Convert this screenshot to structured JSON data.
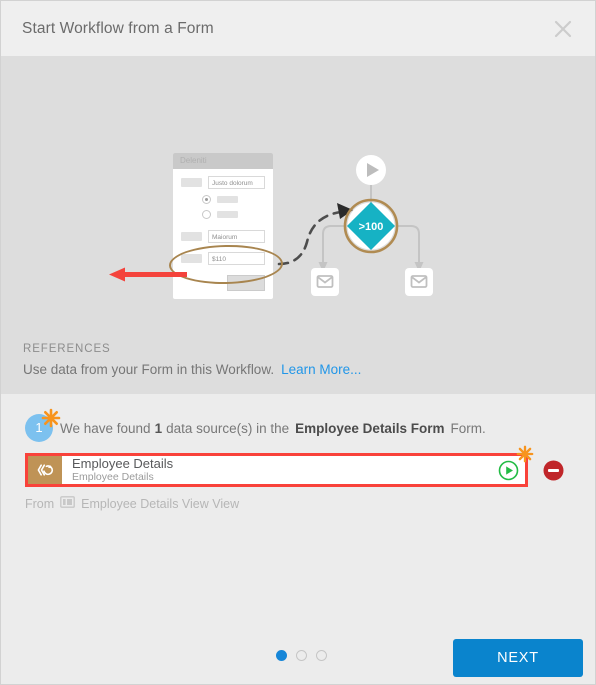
{
  "header": {
    "title": "Start Workflow from a Form",
    "close_icon": "close-icon"
  },
  "illustration": {
    "form_mock": {
      "title": "Deleniti",
      "field1_value": "Justo dolorum",
      "field2_value": "Maiorum",
      "field3_value": "$110"
    },
    "diagram": {
      "start_icon": "play-icon",
      "decision_label": ">100",
      "email_icon_left": "envelope-icon",
      "email_icon_right": "envelope-icon"
    },
    "highlight_ellipse_color": "#a8854f",
    "decision_color": "#16b2c4"
  },
  "references": {
    "title": "REFERENCES",
    "arrow_color": "#f4433c",
    "subtitle": "Use data from your Form in this Workflow.",
    "learn_more": "Learn More..."
  },
  "found": {
    "badge": "1",
    "text_before": "We have found",
    "count": "1",
    "text_middle": "data source(s) in the",
    "form_name": "Employee Details Form",
    "text_after": "Form."
  },
  "data_source": {
    "icon": "data-source-icon",
    "title": "Employee Details",
    "subtitle": "Employee Details",
    "play_icon": "play-circle-icon",
    "remove_icon": "remove-circle-icon",
    "highlight_color": "#f9423a",
    "from_prefix": "From",
    "from_icon": "view-icon",
    "from_value": "Employee Details View View"
  },
  "footer": {
    "dots_total": 3,
    "dots_active_index": 0,
    "next_label": "NEXT",
    "next_color": "#0a84cd"
  }
}
